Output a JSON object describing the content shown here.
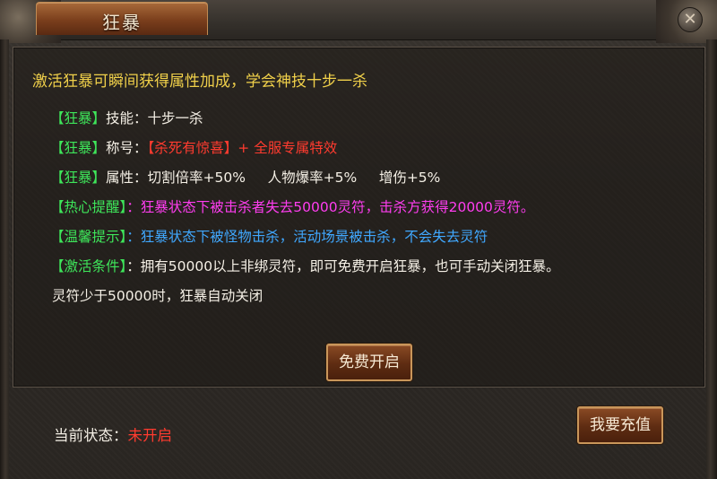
{
  "window": {
    "title": "狂暴",
    "close_glyph": "✕"
  },
  "headline": "激活狂暴可瞬间获得属性加成，学会神技十步一杀",
  "lines": [
    {
      "tag": "【狂暴】",
      "label": "技能：",
      "parts": [
        {
          "text": "十步一杀",
          "color": "white"
        }
      ]
    },
    {
      "tag": "【狂暴】",
      "label": "称号：",
      "parts": [
        {
          "text": "【杀死有惊喜】+  全服专属特效",
          "color": "red"
        }
      ]
    },
    {
      "tag": "【狂暴】",
      "label": "属性：",
      "parts": [
        {
          "text": "切割倍率+50%     人物爆率+5%     增伤+5%",
          "color": "white"
        }
      ]
    },
    {
      "tag": "【热心提醒】",
      "label": "：",
      "parts": [
        {
          "text": "狂暴状态下被击杀者失去50000灵符，击杀方获得20000灵符。",
          "color": "magenta"
        }
      ]
    },
    {
      "tag": "【温馨提示】",
      "label": "：",
      "parts": [
        {
          "text": "狂暴状态下被怪物击杀，活动场景被击杀，不会失去灵符",
          "color": "blue"
        }
      ]
    },
    {
      "tag": "【激活条件】",
      "label": "：",
      "parts": [
        {
          "text": "拥有50000以上非绑灵符，即可免费开启狂暴，也可手动关闭狂暴。",
          "color": "white"
        }
      ]
    }
  ],
  "note": "灵符少于50000时，狂暴自动关闭",
  "buttons": {
    "free_open": "免费开启",
    "recharge": "我要充值"
  },
  "status": {
    "label": "当前状态：",
    "value": "未开启"
  },
  "colors": {
    "green": "#3ee65a",
    "white": "#f5f0e6",
    "red": "#ff3b2f",
    "magenta": "#ff3df0",
    "blue": "#40a8ff",
    "yellow": "#f0d04a"
  }
}
